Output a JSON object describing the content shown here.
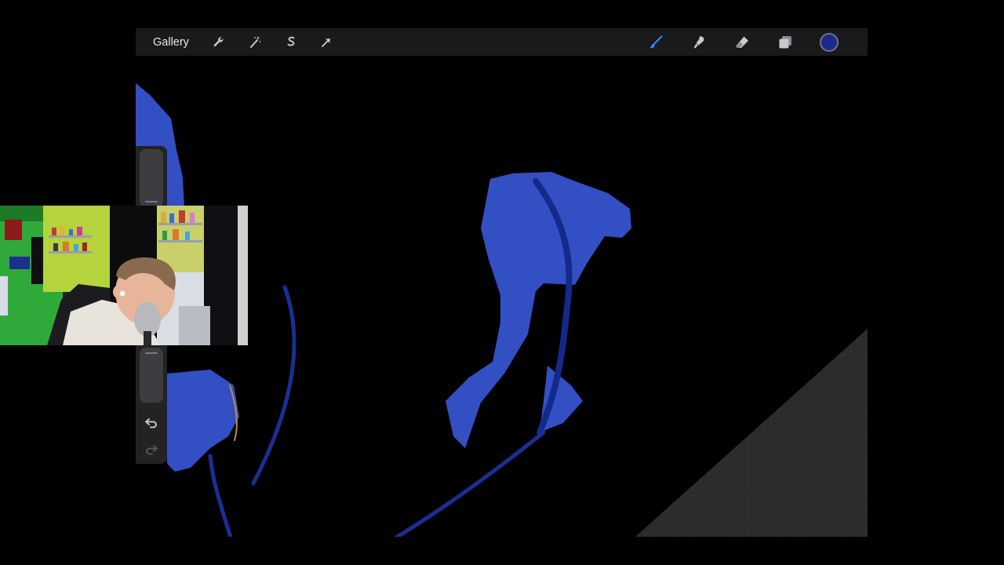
{
  "toolbar": {
    "gallery_label": "Gallery",
    "left_icons": [
      "wrench-icon",
      "magic-wand-icon",
      "selection-icon",
      "transform-arrow-icon"
    ],
    "right_icons": [
      "brush-icon",
      "smudge-icon",
      "eraser-icon",
      "layers-icon"
    ],
    "active_tool": "brush-icon",
    "current_color": "#1d2a8c"
  },
  "sidebar": {
    "controls": [
      "brush-size-slider",
      "modify-button",
      "opacity-slider",
      "undo-button",
      "redo-button"
    ],
    "redo_enabled": false
  },
  "colors": {
    "toolbar_bg": "#1a1a1c",
    "active_icon": "#2f8cff",
    "paint_blue": "#2f4dc6",
    "canvas_bg": "#000000"
  },
  "overlay": {
    "type": "webcam-feed"
  }
}
